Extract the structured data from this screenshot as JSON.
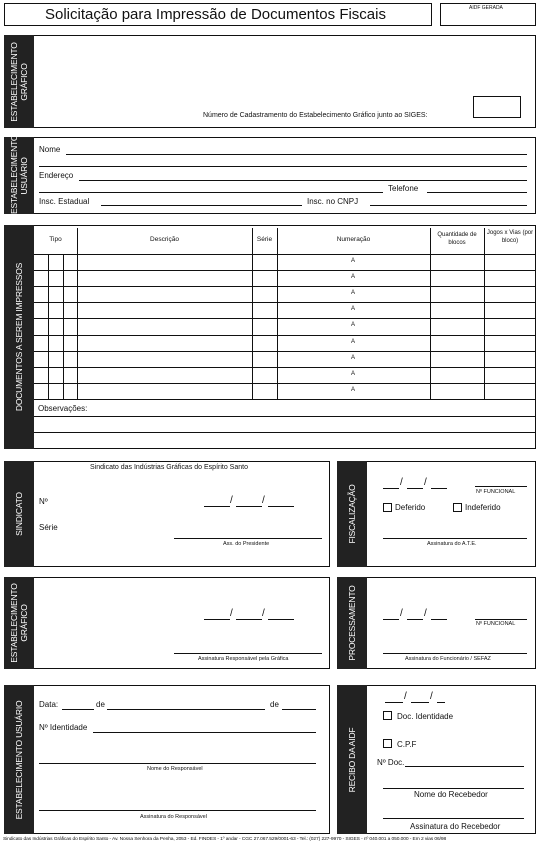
{
  "header": {
    "title": "Solicitação para Impressão de Documentos Fiscais",
    "aidf_label": "AIDF GERADA"
  },
  "sections": {
    "estab_grafico": "ESTABELECIMENTO GRÁFICO",
    "estab_usuario": "ESTABELECIMENTO USUÁRIO",
    "documentos": "DOCUMENTOS A SEREM IMPRESSOS",
    "sindicato": "SINDICATO",
    "fiscalizacao": "FISCALIZAÇÃO",
    "estab_grafico_2": "ESTABELECIMENTO GRÁFICO",
    "processamento": "PROCESSAMENTO",
    "estab_usuario_2": "ESTABELECIMENTO USUÁRIO",
    "recibo": "RECIBO DA AIDF"
  },
  "grafico": {
    "cadastro_label": "Número de Cadastramento do Estabelecimento Gráfico junto ao SIGES:"
  },
  "usuario": {
    "nome": "Nome",
    "endereco": "Endereço",
    "telefone": "Telefone",
    "insc_estadual": "Insc. Estadual",
    "insc_cnpj": "Insc. no CNPJ"
  },
  "table": {
    "headers": {
      "tipo": "Tipo",
      "descricao": "Descrição",
      "serie": "Série",
      "numeracao": "Numeração",
      "quantidade": "Quantidade de blocos",
      "jogos": "Jogos x Vias (por bloco)"
    },
    "range_sep": "A",
    "observacoes": "Observações:"
  },
  "sindicato": {
    "title": "Sindicato das Indústrias Gráficas do Espírito Santo",
    "numero": "Nº",
    "serie": "Série",
    "ass_presidente": "Ass. do Presidente"
  },
  "fiscalizacao": {
    "nfuncional": "Nº FUNCIONAL",
    "deferido": "Deferido",
    "indeferido": "Indeferido",
    "assinatura": "Assinatura do A.T.E."
  },
  "grafico2": {
    "assinatura": "Assinatura Responsável pela Gráfica"
  },
  "processamento": {
    "nfuncional": "Nº FUNCIONAL",
    "assinatura": "Assinatura do Funcionário / SEFAZ"
  },
  "usuario2": {
    "data": "Data:",
    "de1": "de",
    "de2": "de",
    "identidade": "Nº Identidade",
    "nome_resp": "Nome do Responsável",
    "ass_resp": "Assinatura do Responsável"
  },
  "recibo": {
    "doc_identidade": "Doc. Identidade",
    "cpf": "C.P.F",
    "num_doc": "Nº Doc.",
    "nome_recebedor": "Nome do Recebedor",
    "ass_recebedor": "Assinatura do Recebedor"
  },
  "footer": "Sindicato das Indústrias Gráficas do Espírito Santo - Av. Nossa Senhora da Penha, 2053 - Ed. FINDES - 1º andar - CGC 27.067.529/0001-63 - Tel.: (027) 227-9970 - SIGES - nº 040.001 a 050.000 - Em 2 vias 06/98"
}
